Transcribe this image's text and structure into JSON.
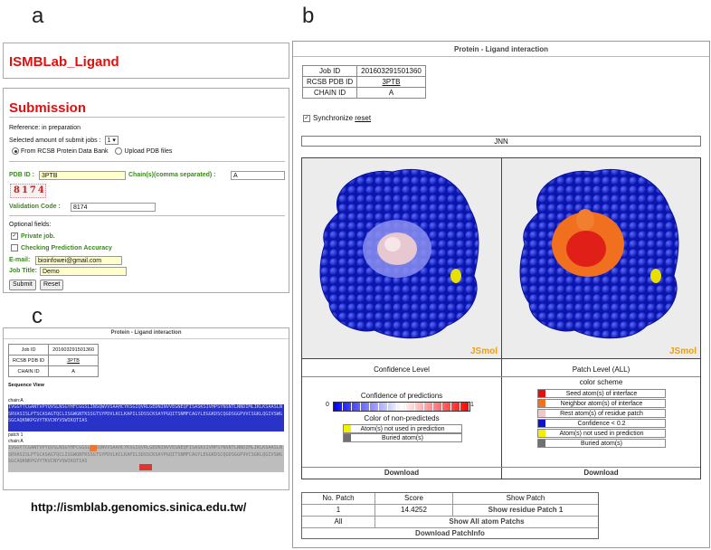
{
  "panel_letters": {
    "a": "a",
    "b": "b",
    "c": "c"
  },
  "panel_a": {
    "brand": "ISMBLab_Ligand",
    "submission_title": "Submission",
    "reference": "Reference: in preparation",
    "selected_jobs_label": "Selected amount of submit jobs :",
    "selected_jobs_value": "1",
    "source_option_1": "From RCSB Protein Data Bank",
    "source_option_2": "Upload PDB files",
    "pdb_id_label": "PDB ID :",
    "pdb_id_value": "3PTB",
    "chain_label": "Chain(s)(comma separated) :",
    "chain_value": "A",
    "captcha": "8174",
    "validation_label": "Validation Code :",
    "validation_value": "8174",
    "optional_fields": "Optional fields:",
    "private_job": "Private job.",
    "checking_accuracy": "Checking Prediction Accuracy",
    "email_label": "E-mail:",
    "email_value": "bioinfowei@gmail.com",
    "job_title_label": "Job Title:",
    "job_title_value": "Demo",
    "submit": "Submit",
    "reset": "Reset"
  },
  "panel_b": {
    "title": "Protein - Ligand interaction",
    "job_id_label": "Job ID",
    "job_id": "201603291501360",
    "pdb_label": "RCSB PDB ID",
    "pdb_id": "3PTB",
    "chain_label": "CHAIN ID",
    "chain_id": "A",
    "synchronize": "Synchronize",
    "reset_link": "reset",
    "ligand": "JNN",
    "jsmol_left": "JSmol",
    "jsmol_right": "JSmol",
    "confidence_header": "Confidence Level",
    "patch_header": "Patch Level (ALL)",
    "confidence_of_predictions": "Confidence of predictions",
    "scale_min": "0",
    "scale_max": "1",
    "non_predicted": "Color of non-predicteds",
    "atoms_not_used": "Atom(s) not used in prediction",
    "buried_atoms": "Buried atom(s)",
    "color_scheme": "color scheme",
    "scheme": [
      {
        "label": "Seed atom(s) of interface",
        "color": "#e01010"
      },
      {
        "label": "Neighbor atom(s) of interface",
        "color": "#f07020"
      },
      {
        "label": "Rest atom(s) of residue patch",
        "color": "#f0c8c8"
      },
      {
        "label": "Confidence < 0.2",
        "color": "#1010d0"
      },
      {
        "label": "Atom(s) not used in prediction",
        "color": "#f0f000"
      },
      {
        "label": "Buried atom(s)",
        "color": "#707070"
      }
    ],
    "download_left": "Download",
    "download_right": "Download",
    "patch_table": {
      "headers": [
        "No. Patch",
        "Score",
        "Show Patch"
      ],
      "row1": [
        "1",
        "14.4252",
        "Show residue Patch 1"
      ],
      "row2_left": "All",
      "row2_right": "Show All atom Patchs",
      "download": "Download PatchInfo"
    }
  },
  "panel_c": {
    "title": "Protein - Ligand interaction",
    "job_id_label": "Job ID",
    "job_id": "201603291501360",
    "pdb_label": "RCSB PDB ID",
    "pdb_id": "3PTB",
    "chain_label": "CHAIN ID",
    "chain_id": "A",
    "sequence_view": "Sequence View",
    "chain_a_1": "chain:A",
    "seq1": "IVGGYTCGANTVPYQVSLNSGYHFCGGSLINSQWVVSAAHCYKSGIQVRLGEDNINVVEGNEQFISASKSIVHPSYNSNTLNNDIMLIKLKSAASLNSRVASISLPTSCASAGTQCLISGWGNTKSSGTSYPDVLKCLKAPILSDSSCKSAYPGQITSNMFCAGYLEGGKDSCQGDSGGPVVCSGKLQGIVSWGSGCAQKNKPGVYTKVCNYVSWIKQTIAS",
    "patch_1": "patch 1",
    "chain_a_2": "chain:A",
    "seq2": "IVGGYTCGANTVPYQVSLNSGYHFCGGSLINSQWVVSAAHCYKSGIQVRLGEDNINVVEGNEQFISASKSIVHPSYNSNTLNNDIMLIKLKSAASLNSRVASISLPTSCASAGTQCLISGWGNTKSSGTSYPDVLKCLKAPILSDSSCKSAYPGQITSNMFCAGYLEGGKDSCQGDSGGPVVCSGKLQGIVSWGSGCAQKNKPGVYTKVCNYVSWIKQTIAS"
  },
  "url": "http://ismblab.genomics.sinica.edu.tw/"
}
